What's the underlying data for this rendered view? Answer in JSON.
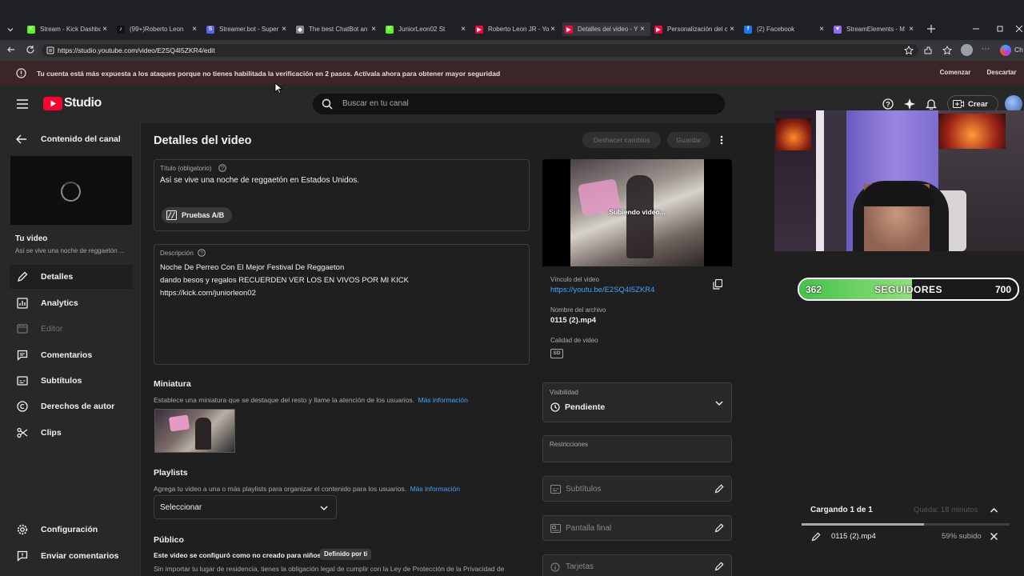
{
  "browser": {
    "tabs": [
      {
        "label": "Stream - Kick Dashboard",
        "icon": "kick-icon",
        "color": "#53fc18"
      },
      {
        "label": "(99+)Roberto Leon",
        "icon": "tiktok-icon",
        "color": "#111111"
      },
      {
        "label": "Streamer.bot - Super",
        "icon": "streamerbot-icon",
        "color": "#5865f2"
      },
      {
        "label": "The best ChatBot an",
        "icon": "chatbot-icon",
        "color": "#888888"
      },
      {
        "label": "JuniorLeon02 St",
        "icon": "kick-icon",
        "color": "#53fc18"
      },
      {
        "label": "Roberto Leon JR - Yo",
        "icon": "youtube-icon",
        "color": "#ff0033"
      },
      {
        "label": "Detalles del video - Y",
        "icon": "youtube-icon",
        "color": "#ff0033"
      },
      {
        "label": "Personalización del c",
        "icon": "youtube-icon",
        "color": "#ff0033"
      },
      {
        "label": "(2) Facebook",
        "icon": "facebook-icon",
        "color": "#1877f2"
      },
      {
        "label": "StreamElements - M",
        "icon": "streamelements-icon",
        "color": "#8f6bff"
      }
    ],
    "url": "https://studio.youtube.com/video/E2SQ4I5ZKR4/edit",
    "profile_label": "Ch"
  },
  "warning": {
    "text": "Tu cuenta está más expuesta a los ataques porque no tienes habilitada la verificación en 2 pasos. Actívala ahora para obtener mayor seguridad",
    "start": "Comenzar",
    "dismiss": "Descartar"
  },
  "header": {
    "logo": "Studio",
    "search_placeholder": "Buscar en tu canal",
    "create": "Crear"
  },
  "sidebar": {
    "back": "Contenido del canal",
    "your_video": "Tu video",
    "video_title_short": "Así se vive una noche de reggaetón ...",
    "items": [
      {
        "label": "Detalles",
        "icon": "pencil-icon"
      },
      {
        "label": "Analytics",
        "icon": "analytics-icon"
      },
      {
        "label": "Editor",
        "icon": "editor-icon"
      },
      {
        "label": "Comentarios",
        "icon": "comments-icon"
      },
      {
        "label": "Subtítulos",
        "icon": "subtitles-icon"
      },
      {
        "label": "Derechos de autor",
        "icon": "copyright-icon"
      },
      {
        "label": "Clips",
        "icon": "scissors-icon"
      }
    ],
    "settings": "Configuración",
    "feedback": "Enviar comentarios"
  },
  "details": {
    "heading": "Detalles del video",
    "undo": "Deshacer cambios",
    "save": "Guardar",
    "title_label": "Título (obligatorio)",
    "title_value": "Así se vive una noche de reggaetón en Estados Unidos.",
    "ab_test": "Pruebas A/B",
    "desc_label": "Descripción",
    "desc_lines": [
      "Noche De Perreo Con El Mejor Festival De Reggaeton",
      "dando besos y regalos  RECUERDEN VER LOS EN VIVOS POR MI KICK",
      "https://kick.com/juniorleon02"
    ],
    "thumb_heading": "Miniatura",
    "thumb_desc": "Establece una miniatura que se destaque del resto y llame la atención de los usuarios.",
    "more_info": "Más información",
    "playlist_heading": "Playlists",
    "playlist_desc": "Agrega tu video a una o más playlists para organizar el contenido para los usuarios.",
    "playlist_select": "Seleccionar",
    "audience_heading": "Público",
    "audience_desc": "Este video se configuró como no creado para niños",
    "audience_badge": "Definido por ti",
    "audience_note": "Sin importar tu lugar de residencia, tienes la obligación legal de cumplir con la Ley de Protección de la Privacidad de"
  },
  "preview": {
    "uploading": "Subiendo video...",
    "link_label": "Vínculo del video",
    "link": "https://youtu.be/E2SQ4I5ZKR4",
    "filename_label": "Nombre del archivo",
    "filename": "0115 (2).mp4",
    "quality_label": "Calidad de video",
    "quality_badge": "SD",
    "visibility_label": "Visibilidad",
    "visibility": "Pendiente",
    "restrictions_label": "Restricciones",
    "subtitles": "Subtítulos",
    "end_screen": "Pantalla final",
    "cards": "Tarjetas"
  },
  "overlay": {
    "followers_current": "362",
    "followers_label": "SEGUIDORES",
    "followers_goal": "700",
    "progress_fraction": 0.517
  },
  "upload": {
    "title": "Cargando 1 de 1",
    "queue": "Queda: 18 minutos",
    "file": "0115 (2).mp4",
    "status": "59% subido",
    "progress": 0.59
  }
}
